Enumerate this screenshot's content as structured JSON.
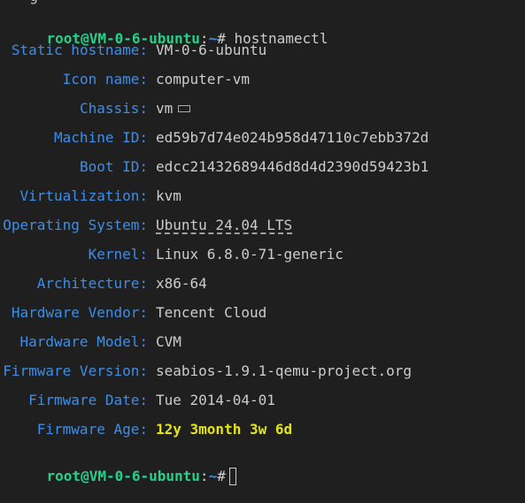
{
  "partial_top": "  g",
  "prompt": {
    "user_host": "root@VM-0-6-ubuntu",
    "sep": ":",
    "path": "~",
    "symbol": "#",
    "command": "hostnamectl"
  },
  "fields": [
    {
      "label": "Static hostname:",
      "value": "VM-0-6-ubuntu"
    },
    {
      "label": "Icon name:",
      "value": "computer-vm"
    },
    {
      "label": "Chassis:",
      "value": "vm",
      "icon": "keyboard-icon"
    },
    {
      "label": "Machine ID:",
      "value": "ed59b7d74e024b958d47110c7ebb372d"
    },
    {
      "label": "Boot ID:",
      "value": "edcc21432689446d8d4d2390d59423b1"
    },
    {
      "label": "Virtualization:",
      "value": "kvm"
    },
    {
      "label": "Operating System:",
      "value": "Ubuntu 24.04 LTS",
      "style": "underline"
    },
    {
      "label": "Kernel:",
      "value": "Linux 6.8.0-71-generic"
    },
    {
      "label": "Architecture:",
      "value": "x86-64"
    },
    {
      "label": "Hardware Vendor:",
      "value": "Tencent Cloud"
    },
    {
      "label": "Hardware Model:",
      "value": "CVM"
    },
    {
      "label": "Firmware Version:",
      "value": "seabios-1.9.1-qemu-project.org"
    },
    {
      "label": "Firmware Date:",
      "value": "Tue 2014-04-01"
    },
    {
      "label": "Firmware Age:",
      "value": "12y 3month 3w 6d",
      "style": "highlight"
    }
  ],
  "bottom_prompt": {
    "user_host": "root@VM-0-6-ubuntu",
    "sep": ":",
    "path": "~",
    "symbol": "#"
  },
  "colors": {
    "background": "#1f1f1f",
    "prompt_green": "#23d18b",
    "label_blue": "#3b8eea",
    "value_text": "#cccccc",
    "highlight_yellow": "#e5e510"
  }
}
